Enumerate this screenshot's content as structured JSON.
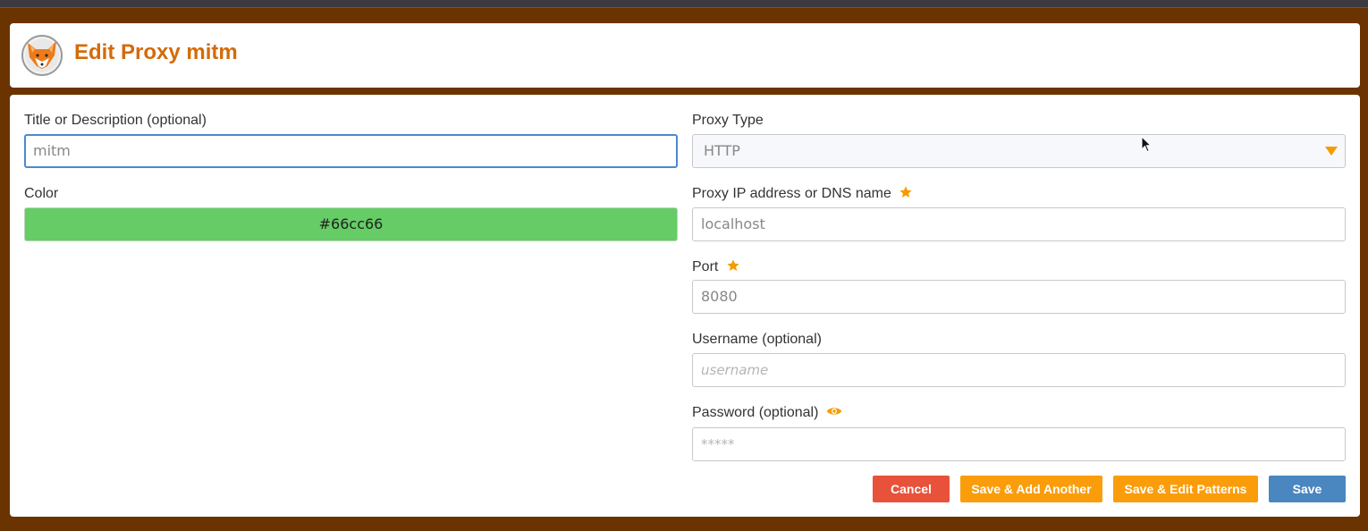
{
  "header": {
    "title": "Edit Proxy mitm",
    "logo_icon": "fox-logo-icon"
  },
  "form": {
    "title_label": "Title or Description (optional)",
    "title_value": "mitm",
    "color_label": "Color",
    "color_value": "#66cc66",
    "proxy_type_label": "Proxy Type",
    "proxy_type_value": "HTTP",
    "address_label": "Proxy IP address or DNS name",
    "address_value": "localhost",
    "port_label": "Port",
    "port_value": "8080",
    "username_label": "Username (optional)",
    "username_placeholder": "username",
    "password_label": "Password (optional)",
    "password_placeholder": "*****"
  },
  "buttons": {
    "cancel": "Cancel",
    "save_add": "Save & Add Another",
    "save_patterns": "Save & Edit Patterns",
    "save": "Save"
  },
  "colors": {
    "background": "#6b3300",
    "accent": "#d46b08",
    "orange": "#fb9d0a",
    "cancel": "#e8523a",
    "save": "#4a86c0",
    "proxy_color": "#66cc66"
  }
}
